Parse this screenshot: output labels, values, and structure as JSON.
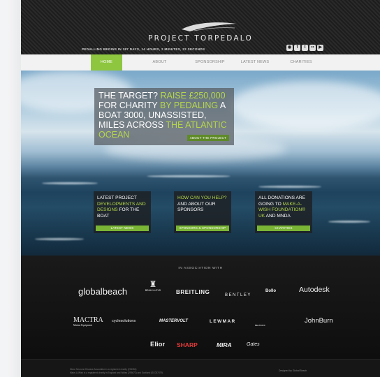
{
  "header": {
    "site_title": "PROJECT TORPEDALO",
    "countdown": "PEDALLING BEGINS IN 187 DAYS, 14 HOURS, 2 MINUTES, 22 SECONDS",
    "social_icons": [
      "rss-icon",
      "facebook-icon",
      "twitter-icon",
      "flickr-icon",
      "youtube-icon"
    ]
  },
  "nav": {
    "items": [
      {
        "label": "HOME",
        "active": true
      },
      {
        "label": "ABOUT",
        "active": false
      },
      {
        "label": "SPONSORSHIP",
        "active": false
      },
      {
        "label": "LATEST NEWS",
        "active": false
      },
      {
        "label": "CHARITIES",
        "active": false
      }
    ]
  },
  "hero": {
    "headline_parts": [
      "THE TARGET? ",
      "RAISE £250,000",
      " FOR CHARITY ",
      "BY PEDALING",
      " A BOAT 3000, UNASSISTED, MILES ACROSS ",
      "THE ATLANTIC OCEAN"
    ],
    "about_button": "ABOUT THE PROJECT"
  },
  "cards": [
    {
      "parts": [
        "LATEST PROJECT ",
        "DEVELOPMENTS AND DESIGNS",
        " FOR THE BOAT"
      ],
      "button": "LATEST NEWS"
    },
    {
      "parts": [
        "HOW CAN YOU HELP?",
        " AND ABOUT OUR SPONSORS",
        ""
      ],
      "button": "SPONSORS & SPONSORSHIP"
    },
    {
      "parts": [
        "ALL DONATIONS ARE GOING TO ",
        "MAKE-A-WISH FOUNDATION® UK",
        " AND MNDA"
      ],
      "button": "CHARITIES"
    }
  ],
  "association": {
    "title": "IN ASSOCIATION WITH",
    "row1": [
      "globalbeach",
      "BEAU LLOYD",
      "BREITLING",
      "BENTLEY",
      "Bollo",
      "Autodesk"
    ],
    "row2": [
      "MACTRA",
      "cyclesolutions",
      "MASTERVOLT",
      "LEWMAR",
      "BELSTAFF",
      "JohnBurn"
    ],
    "row3": [
      "Elior",
      "SHARP",
      "MIRA",
      "Gates"
    ],
    "row2_sub": "Marine Equipment"
  },
  "footer": {
    "line1": "Motor Neurone Disease Association is a registered charity (294354)",
    "line2": "Make-A-Wish is a registered charity in England and Wales (295672) and Scotland (SC037479)",
    "right": "Designed by Global Beach"
  },
  "colors": {
    "accent_green": "#8ec63f",
    "headline_green": "#b6d74a",
    "nav_bg": "#f2f2f2"
  }
}
